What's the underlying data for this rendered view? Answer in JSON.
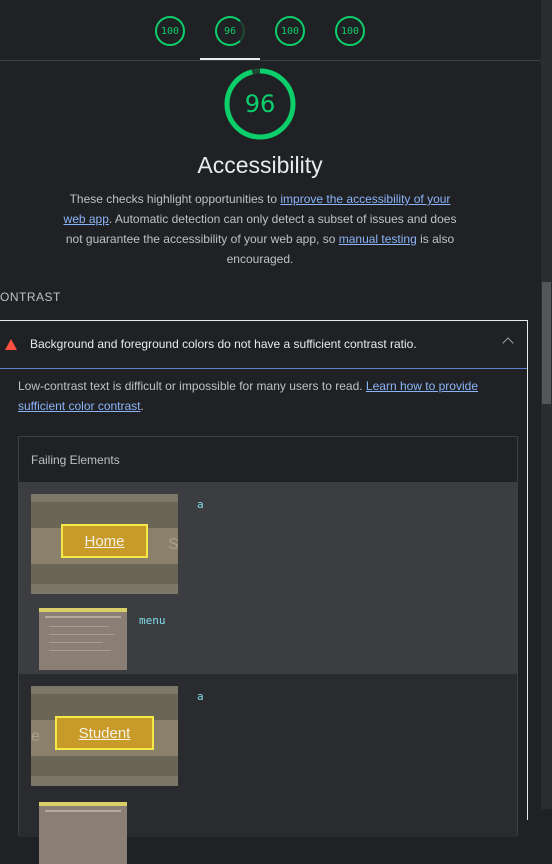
{
  "scores": [
    {
      "label": "100",
      "value": 100
    },
    {
      "label": "96",
      "value": 96,
      "active": true
    },
    {
      "label": "100",
      "value": 100
    },
    {
      "label": "100",
      "value": 100
    }
  ],
  "category": {
    "score_label": "96",
    "score": 96,
    "title": "Accessibility",
    "description": {
      "p1": "These checks highlight opportunities to ",
      "link1": "improve the accessibility of your web app",
      "p2": ". Automatic detection can only detect a subset of issues and does not guarantee the accessibility of your web app, so ",
      "link2": "manual testing",
      "p3": " is also encouraged."
    }
  },
  "group": {
    "title": "ONTRAST"
  },
  "audit": {
    "title": "Background and foreground colors do not have a sufficient contrast ratio.",
    "description": {
      "text": "Low-contrast text is difficult or impossible for many users to read. ",
      "link": "Learn how to provide sufficient color contrast",
      "end": "."
    },
    "table": {
      "header": "Failing Elements",
      "rows": [
        {
          "element_text": "Home",
          "ghost_text": "S",
          "node": "a",
          "parent_node": "menu"
        },
        {
          "element_text": "Student",
          "ghost_text": "e",
          "node": "a"
        }
      ]
    }
  },
  "colors": {
    "pass": "#0cce6b",
    "fail": "#ff4e42",
    "link": "#8ab4f8",
    "background": "#202124"
  }
}
